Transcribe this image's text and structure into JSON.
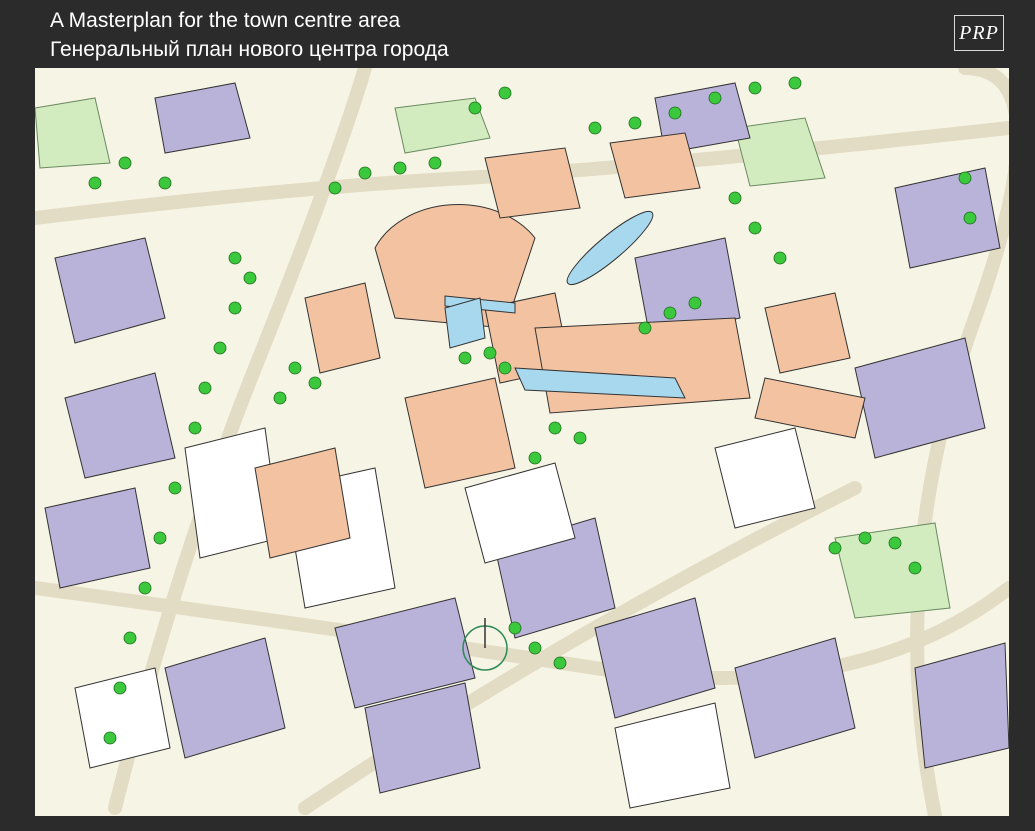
{
  "header": {
    "title_en": "A Masterplan for the town centre area",
    "title_ru": "Генеральный план нового центра города"
  },
  "logo": {
    "text": "PRP"
  },
  "colors": {
    "background": "#2b2b2b",
    "title_text": "#ffffff",
    "ground": "#f6f4e4",
    "existing_building": "#b9b3da",
    "proposed_building": "#f3c3a1",
    "trees": "#3cc83c",
    "green_space": "#d2ecc0",
    "glass": "#a8d8ee"
  }
}
